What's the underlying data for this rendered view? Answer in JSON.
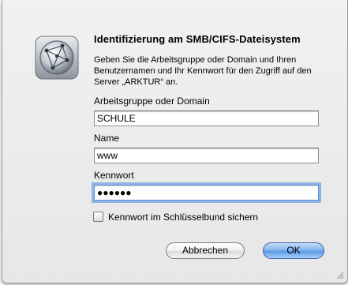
{
  "dialog": {
    "title": "Identifizierung am SMB/CIFS-Dateisystem",
    "description": "Geben Sie die Arbeitsgruppe oder Domain und Ihren Benutzernamen und Ihr Kennwort für den Zugriff auf den Server „ARKTUR“ an.",
    "icon": "network-globe-icon"
  },
  "fields": {
    "workgroup_label": "Arbeitsgruppe oder Domain",
    "workgroup_value": "SCHULE",
    "name_label": "Name",
    "name_value": "www",
    "password_label": "Kennwort",
    "password_value": "●●●●●●"
  },
  "keychain": {
    "label": "Kennwort im Schlüsselbund sichern",
    "checked": false
  },
  "buttons": {
    "cancel": "Abbrechen",
    "ok": "OK"
  },
  "colors": {
    "focus_ring": "#8fb4e6",
    "default_button": "#5d9ae8"
  }
}
